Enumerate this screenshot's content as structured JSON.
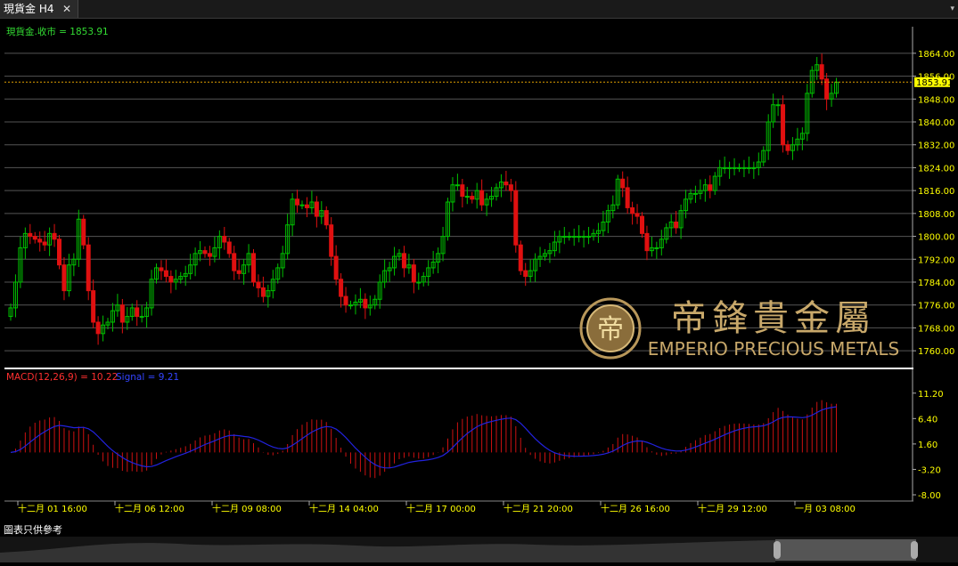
{
  "tab": {
    "title": "現貨金 H4",
    "close": "✕",
    "menu": "▾"
  },
  "price_panel": {
    "label": "現貨金.收市 = 1853.91",
    "current_price": "1853.91"
  },
  "macd_panel": {
    "macd_label": "MACD(12,26,9) = 10.22",
    "signal_label": "Signal = 9.21"
  },
  "watermark": {
    "cn": "帝鋒貴金屬",
    "en": "EMPERIO PRECIOUS METALS"
  },
  "footer_note": "圖表只供參考",
  "colors": {
    "up": "#00c000",
    "down": "#e01010",
    "signal": "#2222dd",
    "macd_hist": "#cc1111",
    "price_line": "#e0a000",
    "axis_text": "#ffff00"
  },
  "chart_data": [
    {
      "type": "candlestick",
      "title": "現貨金.收市",
      "ylim": [
        1756,
        1868
      ],
      "y_ticks": [
        "1864.00",
        "1856.00",
        "1848.00",
        "1840.00",
        "1832.00",
        "1824.00",
        "1816.00",
        "1808.00",
        "1800.00",
        "1792.00",
        "1784.00",
        "1776.00",
        "1768.00",
        "1760.00"
      ],
      "x_ticks": [
        "十二月 01 16:00",
        "十二月 06 12:00",
        "十二月 09 08:00",
        "十二月 14 04:00",
        "十二月 17 00:00",
        "十二月 21 20:00",
        "十二月 26 16:00",
        "十二月 29 12:00",
        "一月 03 08:00"
      ],
      "current_price": 1853.91,
      "closes": [
        1775,
        1784,
        1796,
        1801,
        1800,
        1799,
        1798,
        1797,
        1801,
        1799,
        1790,
        1781,
        1790,
        1792,
        1806,
        1797,
        1781,
        1770,
        1766,
        1769,
        1770,
        1774,
        1776,
        1770,
        1772,
        1775,
        1772,
        1772,
        1775,
        1785,
        1789,
        1788,
        1786,
        1784,
        1785,
        1786,
        1787,
        1790,
        1794,
        1795,
        1794,
        1793,
        1796,
        1800,
        1798,
        1794,
        1788,
        1787,
        1790,
        1794,
        1784,
        1782,
        1779,
        1781,
        1785,
        1789,
        1794,
        1804,
        1813,
        1811,
        1811,
        1810,
        1812,
        1807,
        1809,
        1804,
        1793,
        1785,
        1779,
        1776,
        1776,
        1777,
        1778,
        1775,
        1776,
        1778,
        1784,
        1788,
        1789,
        1793,
        1794,
        1789,
        1790,
        1784,
        1784,
        1786,
        1789,
        1791,
        1794,
        1800,
        1812,
        1818,
        1818,
        1814,
        1814,
        1813,
        1816,
        1811,
        1813,
        1814,
        1817,
        1819,
        1818,
        1816,
        1797,
        1788,
        1786,
        1788,
        1792,
        1793,
        1794,
        1795,
        1798,
        1800,
        1800,
        1800,
        1800,
        1800,
        1800,
        1800,
        1801,
        1802,
        1805,
        1809,
        1811,
        1820,
        1817,
        1810,
        1808,
        1807,
        1801,
        1795,
        1796,
        1796,
        1799,
        1803,
        1805,
        1803,
        1809,
        1813,
        1815,
        1815,
        1816,
        1818,
        1816,
        1821,
        1824,
        1824,
        1824,
        1824,
        1824,
        1824,
        1824,
        1824,
        1826,
        1830,
        1840,
        1846,
        1846,
        1832,
        1830,
        1832,
        1834,
        1836,
        1850,
        1858,
        1860,
        1855,
        1848,
        1850,
        1853.91
      ],
      "series": [
        {
          "name": "MACD(12,26,9)",
          "ylim": [
            -8,
            12
          ],
          "y_ticks": [
            "11.20",
            "6.40",
            "1.60",
            "-3.20",
            "-8.00"
          ],
          "current": 10.22
        },
        {
          "name": "Signal",
          "current": 9.21
        }
      ]
    }
  ]
}
